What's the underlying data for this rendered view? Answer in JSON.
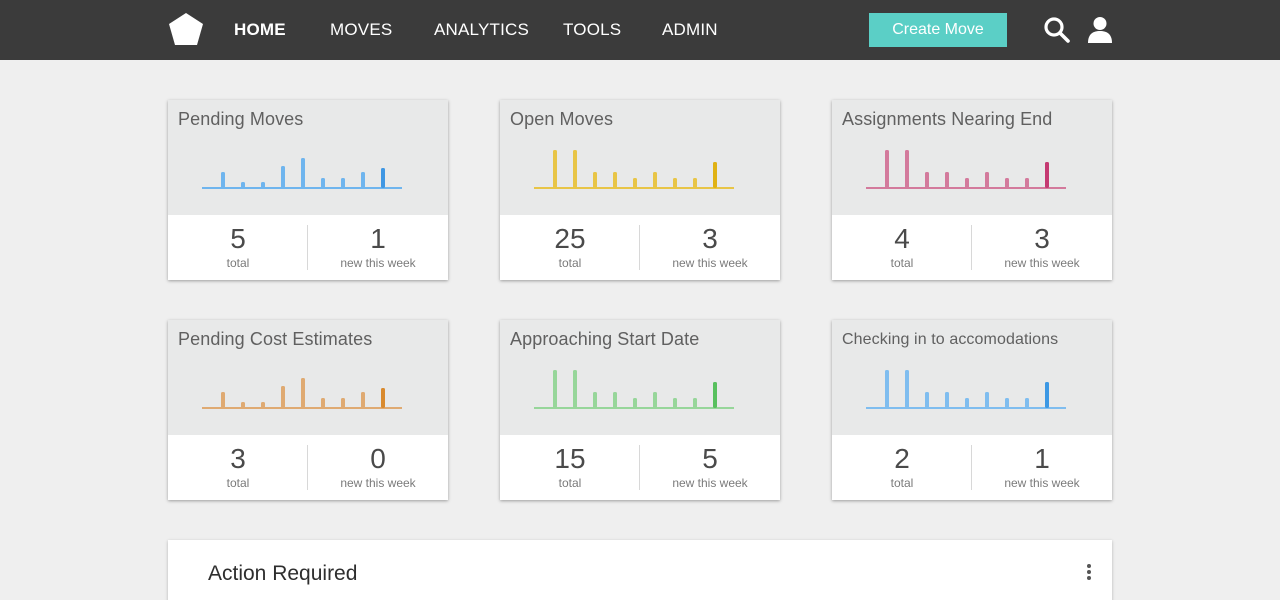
{
  "nav": {
    "logo_icon": "pentagon-logo-icon",
    "items": [
      {
        "label": "HOME",
        "active": true
      },
      {
        "label": "MOVES"
      },
      {
        "label": "ANALYTICS"
      },
      {
        "label": "TOOLS"
      },
      {
        "label": "ADMIN"
      }
    ],
    "create_button": "Create Move",
    "search_icon": "search-icon",
    "user_icon": "user-icon"
  },
  "cards": [
    {
      "title": "Pending Moves",
      "color": "#6fb5ee",
      "highlight": "#3f97e3",
      "bars": [
        0.4,
        0.15,
        0.15,
        0.55,
        0.75,
        0.25,
        0.25,
        0.4,
        0.5
      ],
      "total": "5",
      "total_label": "total",
      "new": "1",
      "new_label": "new this week"
    },
    {
      "title": "Open Moves",
      "color": "#e8c547",
      "highlight": "#e0b214",
      "bars": [
        0.95,
        0.95,
        0.4,
        0.4,
        0.25,
        0.4,
        0.25,
        0.25,
        0.65
      ],
      "total": "25",
      "total_label": "total",
      "new": "3",
      "new_label": "new this week"
    },
    {
      "title": "Assignments Nearing End",
      "color": "#d37a9c",
      "highlight": "#c53a72",
      "bars": [
        0.95,
        0.95,
        0.4,
        0.4,
        0.25,
        0.4,
        0.25,
        0.25,
        0.65
      ],
      "total": "4",
      "total_label": "total",
      "new": "3",
      "new_label": "new this week"
    },
    {
      "title": "Pending Cost Estimates",
      "color": "#dfaa72",
      "highlight": "#d98a2e",
      "bars": [
        0.4,
        0.15,
        0.15,
        0.55,
        0.75,
        0.25,
        0.25,
        0.4,
        0.5
      ],
      "total": "3",
      "total_label": "total",
      "new": "0",
      "new_label": "new this week"
    },
    {
      "title": "Approaching Start Date",
      "color": "#97d69a",
      "highlight": "#58c05e",
      "bars": [
        0.95,
        0.95,
        0.4,
        0.4,
        0.25,
        0.4,
        0.25,
        0.25,
        0.65
      ],
      "total": "15",
      "total_label": "total",
      "new": "5",
      "new_label": "new this week"
    },
    {
      "title": "Checking in to accomodations",
      "color": "#7fbdef",
      "highlight": "#3c98e4",
      "bars": [
        0.95,
        0.95,
        0.4,
        0.4,
        0.25,
        0.4,
        0.25,
        0.25,
        0.65
      ],
      "total": "2",
      "total_label": "total",
      "new": "1",
      "new_label": "new this week"
    }
  ],
  "action_panel": {
    "title": "Action Required",
    "menu_icon": "kebab-menu-icon"
  }
}
